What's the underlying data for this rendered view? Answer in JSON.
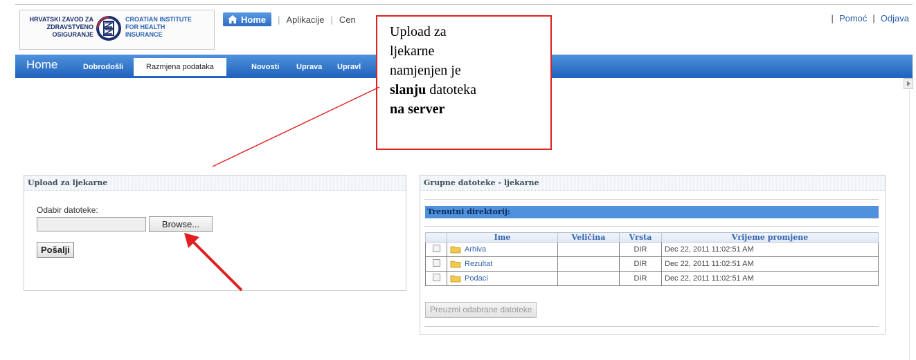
{
  "logo": {
    "hr_text": "HRVATSKI ZAVOD ZA\nZDRAVSTVENO\nOSIGURANJE",
    "en_text": "CROATIAN INSTITUTE\nFOR HEALTH\nINSURANCE"
  },
  "topnav": {
    "home": "Home",
    "aplikacije": "Aplikacije",
    "cen": "Cen"
  },
  "toplinks": {
    "pomoc": "Pomoć",
    "odjava": "Odjava",
    "sep": "|"
  },
  "tabbar": {
    "title": "Home",
    "tabs": [
      "Dobrodošli",
      "Razmjena podataka",
      "Novosti",
      "Uprava",
      "Upravl"
    ]
  },
  "upload": {
    "title": "Upload za ljekarne",
    "file_label": "Odabir datoteke:",
    "browse": "Browse...",
    "send": "Pošalji"
  },
  "grupne": {
    "title": "Grupne datoteke - ljekarne",
    "current_dir": "Trenutni direktorij:",
    "columns": [
      "Ime",
      "Veličina",
      "Vrsta",
      "Vrijeme promjene"
    ],
    "rows": [
      {
        "name": "Arhiva",
        "size": "",
        "type": "DIR",
        "modified": "Dec 22, 2011 11:02:51 AM"
      },
      {
        "name": "Rezultat",
        "size": "",
        "type": "DIR",
        "modified": "Dec 22, 2011 11:02:51 AM"
      },
      {
        "name": "Podaci",
        "size": "",
        "type": "DIR",
        "modified": "Dec 22, 2011 11:02:51 AM"
      }
    ],
    "download": "Preuzmi odabrane datoteke"
  },
  "callout": {
    "line1": "Upload za",
    "line2": "ljekarne",
    "line3": "namjenjen je",
    "line4_bold": "slanju",
    "line4_rest": " datoteka",
    "line5_bold": "na server"
  },
  "colors": {
    "accent": "#2d6cc4",
    "tabbar": "#3b7fd1",
    "annotation": "#e02020"
  },
  "icons": {
    "home": "house-icon",
    "folder": "folder-icon",
    "scroll": "chevron-right-icon"
  }
}
